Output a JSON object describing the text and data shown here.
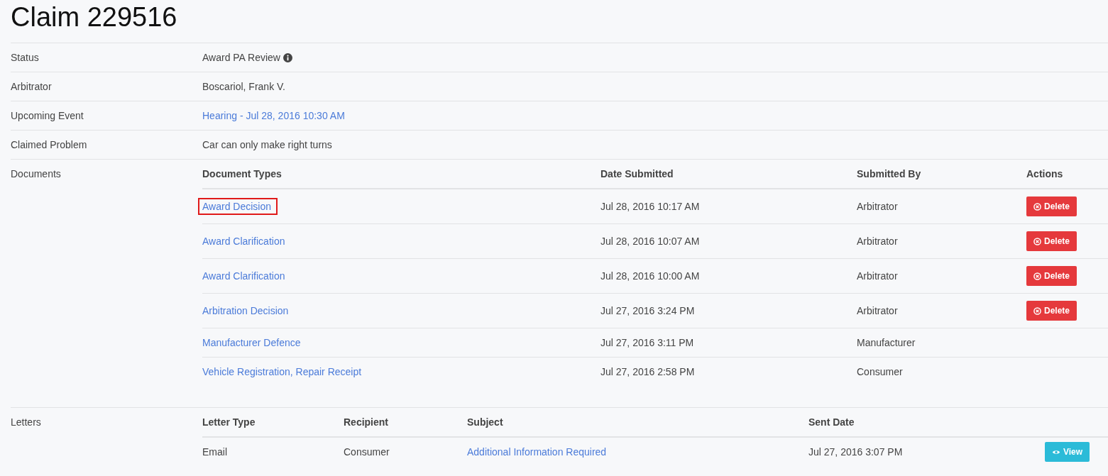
{
  "title": "Claim 229516",
  "fields": [
    {
      "label": "Status",
      "value": "Award PA Review",
      "kind": "info"
    },
    {
      "label": "Arbitrator",
      "value": "Boscariol, Frank V.",
      "kind": "text"
    },
    {
      "label": "Upcoming Event",
      "value": "Hearing - Jul 28, 2016 10:30 AM",
      "kind": "link"
    },
    {
      "label": "Claimed Problem",
      "value": "Car can only make right turns",
      "kind": "text"
    }
  ],
  "documents": {
    "label": "Documents",
    "columns": [
      "Document Types",
      "Date Submitted",
      "Submitted By",
      "Actions"
    ],
    "rows": [
      {
        "type": "Award Decision",
        "date": "Jul 28, 2016 10:17 AM",
        "by": "Arbitrator",
        "action": "Delete",
        "highlighted": true
      },
      {
        "type": "Award Clarification",
        "date": "Jul 28, 2016 10:07 AM",
        "by": "Arbitrator",
        "action": "Delete",
        "highlighted": false
      },
      {
        "type": "Award Clarification",
        "date": "Jul 28, 2016 10:00 AM",
        "by": "Arbitrator",
        "action": "Delete",
        "highlighted": false
      },
      {
        "type": "Arbitration Decision",
        "date": "Jul 27, 2016 3:24 PM",
        "by": "Arbitrator",
        "action": "Delete",
        "highlighted": false
      },
      {
        "type": "Manufacturer Defence",
        "date": "Jul 27, 2016 3:11 PM",
        "by": "Manufacturer",
        "highlighted": false
      },
      {
        "type": "Vehicle Registration, Repair Receipt",
        "date": "Jul 27, 2016 2:58 PM",
        "by": "Consumer",
        "highlighted": false
      }
    ]
  },
  "letters": {
    "label": "Letters",
    "columns": [
      "Letter Type",
      "Recipient",
      "Subject",
      "Sent Date"
    ],
    "rows": [
      {
        "type": "Email",
        "recipient": "Consumer",
        "subject": "Additional Information Required",
        "sent": "Jul 27, 2016 3:07 PM",
        "action": "View"
      }
    ]
  }
}
